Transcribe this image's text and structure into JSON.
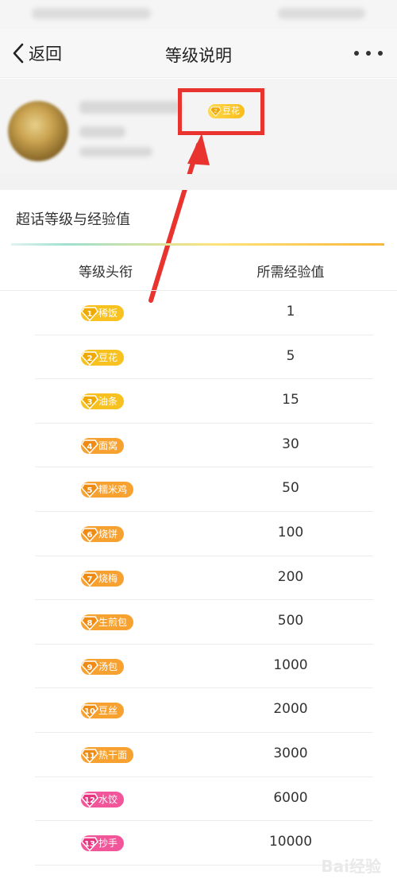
{
  "header": {
    "back_label": "返回",
    "title": "等级说明"
  },
  "profile": {
    "badge_label": "豆花",
    "badge_level": "2"
  },
  "section": {
    "title": "超话等级与经验值"
  },
  "table": {
    "col_title": "等级头衔",
    "col_exp": "所需经验值",
    "rows": [
      {
        "level": "1",
        "title": "稀饭",
        "exp": "1"
      },
      {
        "level": "2",
        "title": "豆花",
        "exp": "5"
      },
      {
        "level": "3",
        "title": "油条",
        "exp": "15"
      },
      {
        "level": "4",
        "title": "面窝",
        "exp": "30"
      },
      {
        "level": "5",
        "title": "糯米鸡",
        "exp": "50"
      },
      {
        "level": "6",
        "title": "烧饼",
        "exp": "100"
      },
      {
        "level": "7",
        "title": "烧梅",
        "exp": "200"
      },
      {
        "level": "8",
        "title": "生煎包",
        "exp": "500"
      },
      {
        "level": "9",
        "title": "汤包",
        "exp": "1000"
      },
      {
        "level": "10",
        "title": "豆丝",
        "exp": "2000"
      },
      {
        "level": "11",
        "title": "热干面",
        "exp": "3000"
      },
      {
        "level": "12",
        "title": "水饺",
        "exp": "6000"
      },
      {
        "level": "13",
        "title": "抄手",
        "exp": "10000"
      }
    ]
  },
  "colors": {
    "badge_yellow": "#f7c21f",
    "badge_orange": "#f7a230",
    "badge_pink": "#f2559a",
    "annotation_red": "#e8332e"
  },
  "watermark": "Bai经验"
}
